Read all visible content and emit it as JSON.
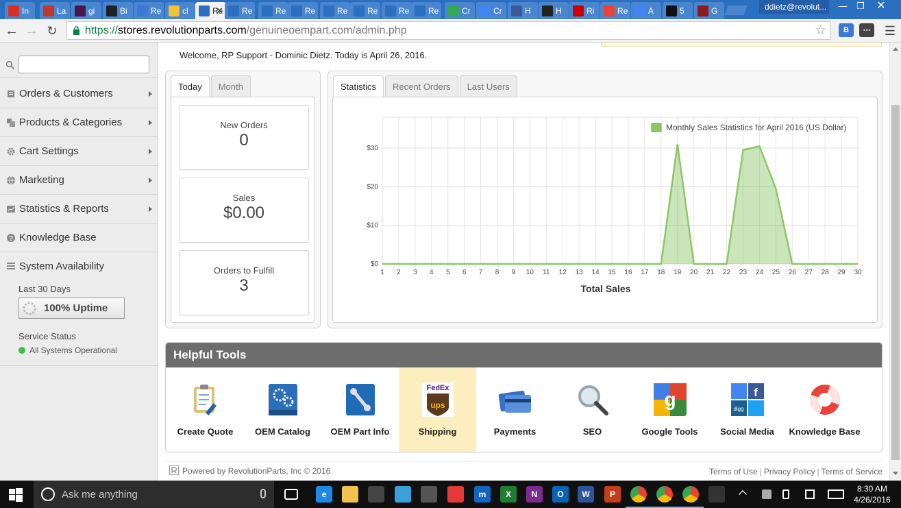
{
  "browser": {
    "tabs": [
      {
        "label": "In",
        "favicon": "gmail-icon",
        "color": "#d93025"
      },
      {
        "label": "La",
        "favicon": "lastpass-icon",
        "color": "#c0392b"
      },
      {
        "label": "gi",
        "favicon": "slack-icon",
        "color": "#4a154b"
      },
      {
        "label": "Bi",
        "favicon": "revolutionparts-icon",
        "color": "#222222"
      },
      {
        "label": "Re",
        "favicon": "calendar-icon",
        "color": "#3c78d8"
      },
      {
        "label": "cl",
        "favicon": "smiley-icon",
        "color": "#f1c232"
      },
      {
        "label": "Re",
        "favicon": "revolutionparts-icon",
        "color": "#2b6fc0"
      },
      {
        "label": "Re",
        "favicon": "revolutionparts-icon",
        "color": "#2b6fc0"
      },
      {
        "label": "Re",
        "favicon": "revolutionparts-icon",
        "color": "#2b6fc0"
      },
      {
        "label": "Re",
        "favicon": "revolutionparts-icon",
        "color": "#2b6fc0"
      },
      {
        "label": "Re",
        "favicon": "revolutionparts-icon",
        "color": "#2b6fc0"
      },
      {
        "label": "Re",
        "favicon": "revolutionparts-icon",
        "color": "#2b6fc0"
      },
      {
        "label": "Re",
        "favicon": "revolutionparts-icon",
        "color": "#2b6fc0"
      },
      {
        "label": "Re",
        "favicon": "revolutionparts-icon",
        "color": "#2b6fc0"
      },
      {
        "label": "Cr",
        "favicon": "chrome-icon",
        "color": "#34a853"
      },
      {
        "label": "Cr",
        "favicon": "chrome-icon",
        "color": "#4285f4"
      },
      {
        "label": "H",
        "favicon": "facebook-icon",
        "color": "#3b5998"
      },
      {
        "label": "H",
        "favicon": "revolutionparts-icon",
        "color": "#222222"
      },
      {
        "label": "Ri",
        "favicon": "toyota-icon",
        "color": "#cc0000"
      },
      {
        "label": "Re",
        "favicon": "google-icon",
        "color": "#ea4335"
      },
      {
        "label": "A",
        "favicon": "google-icon",
        "color": "#4285f4"
      },
      {
        "label": "5",
        "favicon": "l-icon",
        "color": "#111111"
      },
      {
        "label": "G",
        "favicon": "vr-icon",
        "color": "#8e1b1b"
      }
    ],
    "active_tab_label": "Re",
    "user": "ddietz@revolut...",
    "url_scheme": "https://",
    "url_host": "stores.revolutionparts.com",
    "url_path": "/genuineoempart.com/admin.php"
  },
  "sidebar": {
    "search_placeholder": "",
    "items": [
      {
        "label": "Orders & Customers",
        "icon": "orders-icon"
      },
      {
        "label": "Products & Categories",
        "icon": "products-icon"
      },
      {
        "label": "Cart Settings",
        "icon": "gear-icon"
      },
      {
        "label": "Marketing",
        "icon": "globe-icon"
      },
      {
        "label": "Statistics & Reports",
        "icon": "chart-icon"
      },
      {
        "label": "Knowledge Base",
        "icon": "question-icon"
      }
    ],
    "availability": {
      "title": "System Availability",
      "period": "Last 30 Days",
      "uptime": "100% Uptime",
      "status_label": "Service Status",
      "status_text": "All Systems Operational",
      "status_color": "#3cbf4a"
    }
  },
  "welcome": "Welcome, RP Support - Dominic Dietz. Today is April 26, 2016.",
  "summary_panel": {
    "tabs": [
      "Today",
      "Month"
    ],
    "active_tab": "Today",
    "stats": [
      {
        "label": "New Orders",
        "value": "0"
      },
      {
        "label": "Sales",
        "value": "$0.00"
      },
      {
        "label": "Orders to Fulfill",
        "value": "3"
      }
    ]
  },
  "stats_panel": {
    "tabs": [
      "Statistics",
      "Recent Orders",
      "Last Users"
    ],
    "active_tab": "Statistics"
  },
  "chart_data": {
    "type": "area",
    "title": "",
    "xlabel": "Total Sales",
    "ylabel": "",
    "x": [
      1,
      2,
      3,
      4,
      5,
      6,
      7,
      8,
      9,
      10,
      11,
      12,
      13,
      14,
      15,
      16,
      17,
      18,
      19,
      20,
      21,
      22,
      23,
      24,
      25,
      26,
      27,
      28,
      29,
      30
    ],
    "y_ticks": [
      "$0",
      "$10",
      "$20",
      "$30"
    ],
    "ylim": [
      0,
      38
    ],
    "grid": true,
    "legend_position": "top-right",
    "series": [
      {
        "name": "Monthly Sales Statistics for April 2016 (US Dollar)",
        "color": "#8cc665",
        "values": [
          0,
          0,
          0,
          0,
          0,
          0,
          0,
          0,
          0,
          0,
          0,
          0,
          0,
          0,
          0,
          0,
          0,
          0,
          31,
          0,
          0,
          0,
          29.5,
          30.5,
          19.5,
          0,
          0,
          0,
          0,
          0
        ]
      }
    ]
  },
  "helpful_tools": {
    "title": "Helpful Tools",
    "items": [
      {
        "label": "Create Quote",
        "icon": "clipboard-icon"
      },
      {
        "label": "OEM Catalog",
        "icon": "catalog-icon"
      },
      {
        "label": "OEM Part Info",
        "icon": "part-info-icon"
      },
      {
        "label": "Shipping",
        "icon": "fedex-ups-icon"
      },
      {
        "label": "Payments",
        "icon": "credit-card-icon"
      },
      {
        "label": "SEO",
        "icon": "magnifier-icon"
      },
      {
        "label": "Google Tools",
        "icon": "google-icon"
      },
      {
        "label": "Social Media",
        "icon": "social-icon"
      },
      {
        "label": "Knowledge Base",
        "icon": "lifebuoy-icon"
      }
    ],
    "active_item": "Shipping"
  },
  "footer": {
    "powered": "Powered by RevolutionParts, Inc © 2016",
    "links": [
      "Terms of Use",
      "Privacy Policy",
      "Terms of Service"
    ]
  },
  "taskbar": {
    "search_placeholder": "Ask me anything",
    "time": "8:30 AM",
    "date": "4/26/2016",
    "apps": [
      {
        "name": "task-view-icon",
        "label": "",
        "color": "#101010"
      },
      {
        "name": "edge-icon",
        "label": "e",
        "color": "#1e88e5"
      },
      {
        "name": "file-explorer-icon",
        "label": "",
        "color": "#f2c14e"
      },
      {
        "name": "store-icon",
        "label": "",
        "color": "#444444"
      },
      {
        "name": "mail-icon",
        "label": "",
        "color": "#3aa0d8"
      },
      {
        "name": "pen-icon",
        "label": "",
        "color": "#555555"
      },
      {
        "name": "cloud-icon",
        "label": "",
        "color": "#e53935"
      },
      {
        "name": "m-icon",
        "label": "m",
        "color": "#1565c0"
      },
      {
        "name": "excel-icon",
        "label": "X",
        "color": "#1e7e34"
      },
      {
        "name": "onenote-icon",
        "label": "N",
        "color": "#7b2d8e"
      },
      {
        "name": "outlook-icon",
        "label": "O",
        "color": "#0a64b6"
      },
      {
        "name": "word-icon",
        "label": "W",
        "color": "#2b579a"
      },
      {
        "name": "powerpoint-icon",
        "label": "P",
        "color": "#c43e1c"
      },
      {
        "name": "chrome-icon",
        "label": "",
        "color": "#34a853"
      },
      {
        "name": "chrome-icon",
        "label": "",
        "color": "#34a853"
      },
      {
        "name": "chrome-icon",
        "label": "",
        "color": "#34a853"
      },
      {
        "name": "calculator-icon",
        "label": "",
        "color": "#333333"
      }
    ]
  },
  "colors": {
    "chrome_blue": "#2b6fc0",
    "series_green": "#8cc665",
    "active_tool_bg": "#fdeebf"
  }
}
